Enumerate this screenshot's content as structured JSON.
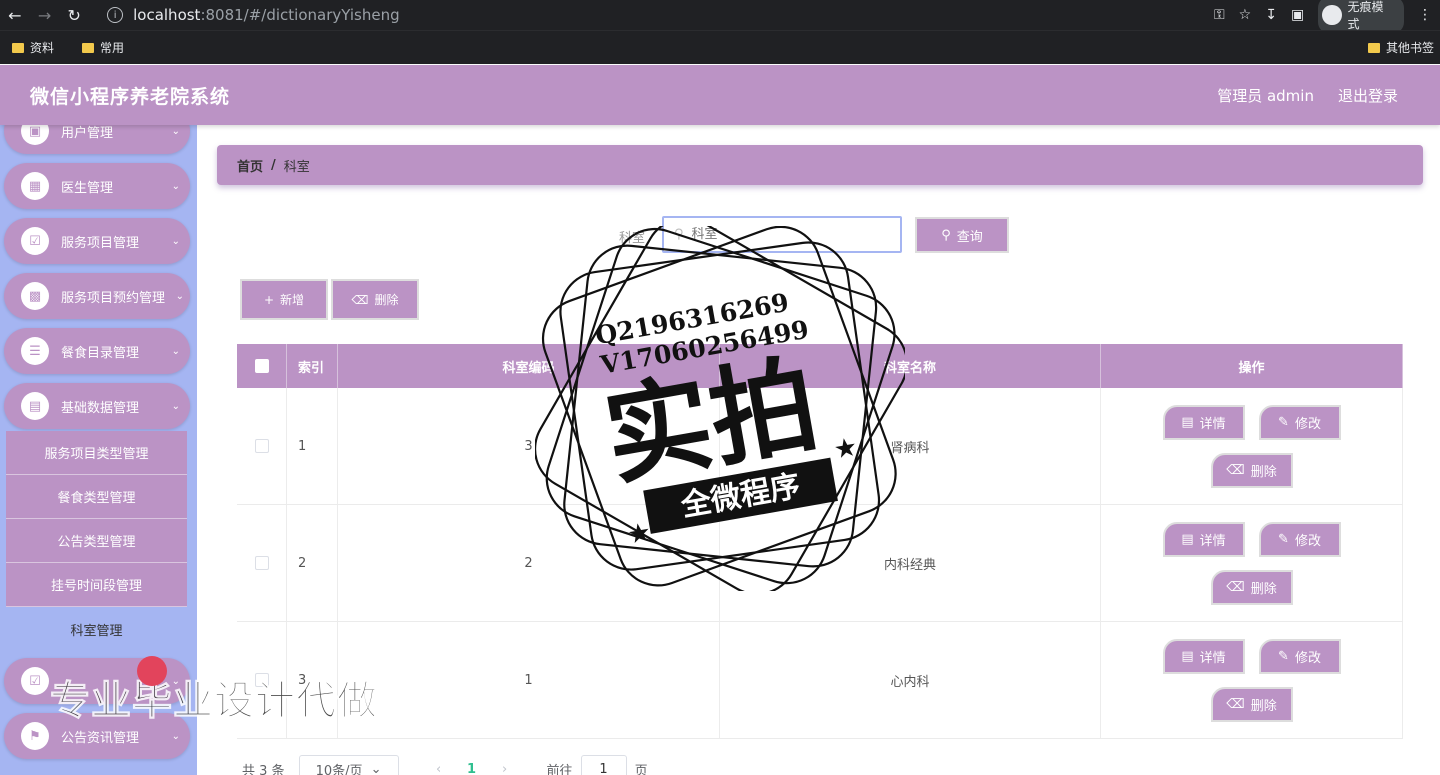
{
  "browser": {
    "url_host": "localhost",
    "url_path": ":8081/#/dictionaryYisheng",
    "incognito_label": "无痕模式",
    "bookmarks": [
      "资料",
      "常用"
    ],
    "bookmarks_right": "其他书签"
  },
  "header": {
    "title": "微信小程序养老院系统",
    "user": "管理员 admin",
    "logout": "退出登录"
  },
  "sidebar": {
    "menus": [
      {
        "label": "用户管理",
        "icon": "user-icon"
      },
      {
        "label": "医生管理",
        "icon": "grid-icon"
      },
      {
        "label": "服务项目管理",
        "icon": "clipboard-icon"
      },
      {
        "label": "服务项目预约管理",
        "icon": "apps-icon"
      },
      {
        "label": "餐食目录管理",
        "icon": "list-icon"
      },
      {
        "label": "基础数据管理",
        "icon": "database-icon"
      }
    ],
    "submenu": [
      "服务项目类型管理",
      "餐食类型管理",
      "公告类型管理",
      "挂号时间段管理",
      "科室管理"
    ],
    "menus_after": [
      {
        "label": "公告资讯管理",
        "icon": "flag-icon"
      }
    ]
  },
  "breadcrumb": {
    "home": "首页",
    "sep": "/",
    "current": "科室"
  },
  "search": {
    "label": "科室",
    "placeholder": "科室",
    "button": "查询"
  },
  "actions": {
    "add": "新增",
    "delete": "删除"
  },
  "table": {
    "columns": [
      "索引",
      "科室编码",
      "科室名称",
      "操作"
    ],
    "rows": [
      {
        "index": "1",
        "code": "3",
        "name": "肾病科"
      },
      {
        "index": "2",
        "code": "2",
        "name": "内科经典"
      },
      {
        "index": "3",
        "code": "1",
        "name": "心内科"
      }
    ],
    "ops": {
      "detail": "详情",
      "edit": "修改",
      "delete": "删除"
    }
  },
  "pager": {
    "total": "共 3 条",
    "size": "10条/页",
    "page": "1",
    "goto_prefix": "前往",
    "goto_value": "1",
    "goto_suffix": "页"
  },
  "watermark": {
    "q": "Q2196316269",
    "v": "V17060256499",
    "main": "实拍",
    "sub": "全微程序",
    "bottom": "专业毕业设计代做"
  },
  "colors": {
    "primary": "#bb93c5",
    "sidebar": "#a5b5f2",
    "page_active": "#2fbf8f"
  }
}
